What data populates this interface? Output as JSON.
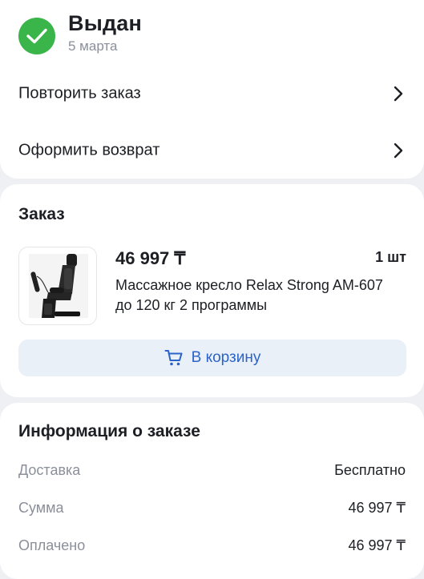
{
  "status": {
    "title": "Выдан",
    "date": "5 марта",
    "icon": "check-circle-icon",
    "color": "#39b54a"
  },
  "actions": [
    {
      "label": "Повторить заказ",
      "icon": "chevron-right-icon"
    },
    {
      "label": "Оформить возврат",
      "icon": "chevron-right-icon"
    }
  ],
  "order": {
    "title": "Заказ",
    "item": {
      "price": "46 997 ₸",
      "quantity": "1 шт",
      "name": "Массажное кресло Relax Strong AM-607 до 120 кг 2 программы"
    },
    "cart_button": {
      "label": "В корзину",
      "icon": "cart-icon",
      "color": "#2a63c9"
    }
  },
  "info": {
    "title": "Информация о заказе",
    "rows": [
      {
        "key": "Доставка",
        "value": "Бесплатно"
      },
      {
        "key": "Сумма",
        "value": "46 997 ₸"
      },
      {
        "key": "Оплачено",
        "value": "46 997 ₸"
      }
    ]
  }
}
